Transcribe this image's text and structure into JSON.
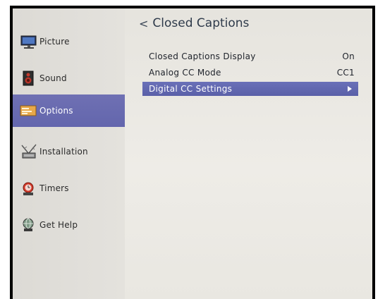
{
  "sidebar": {
    "items": [
      {
        "label": "Picture",
        "icon": "monitor-icon"
      },
      {
        "label": "Sound",
        "icon": "speaker-icon"
      },
      {
        "label": "Options",
        "icon": "options-icon",
        "selected": true
      },
      {
        "label": "Installation",
        "icon": "antenna-icon"
      },
      {
        "label": "Timers",
        "icon": "alarm-clock-icon"
      },
      {
        "label": "Get Help",
        "icon": "help-globe-icon"
      }
    ]
  },
  "main": {
    "back_glyph": "<",
    "title": "Closed Captions",
    "rows": [
      {
        "label": "Closed Captions Display",
        "value": "On"
      },
      {
        "label": "Analog CC Mode",
        "value": "CC1"
      },
      {
        "label": "Digital CC Settings",
        "value": "",
        "selected": true,
        "icon": "arrow-right-icon"
      }
    ]
  },
  "colors": {
    "selection": "#6366ad",
    "sidebar_bg": "#dcdad5",
    "content_bg": "#eceae5",
    "frame": "#000000"
  }
}
